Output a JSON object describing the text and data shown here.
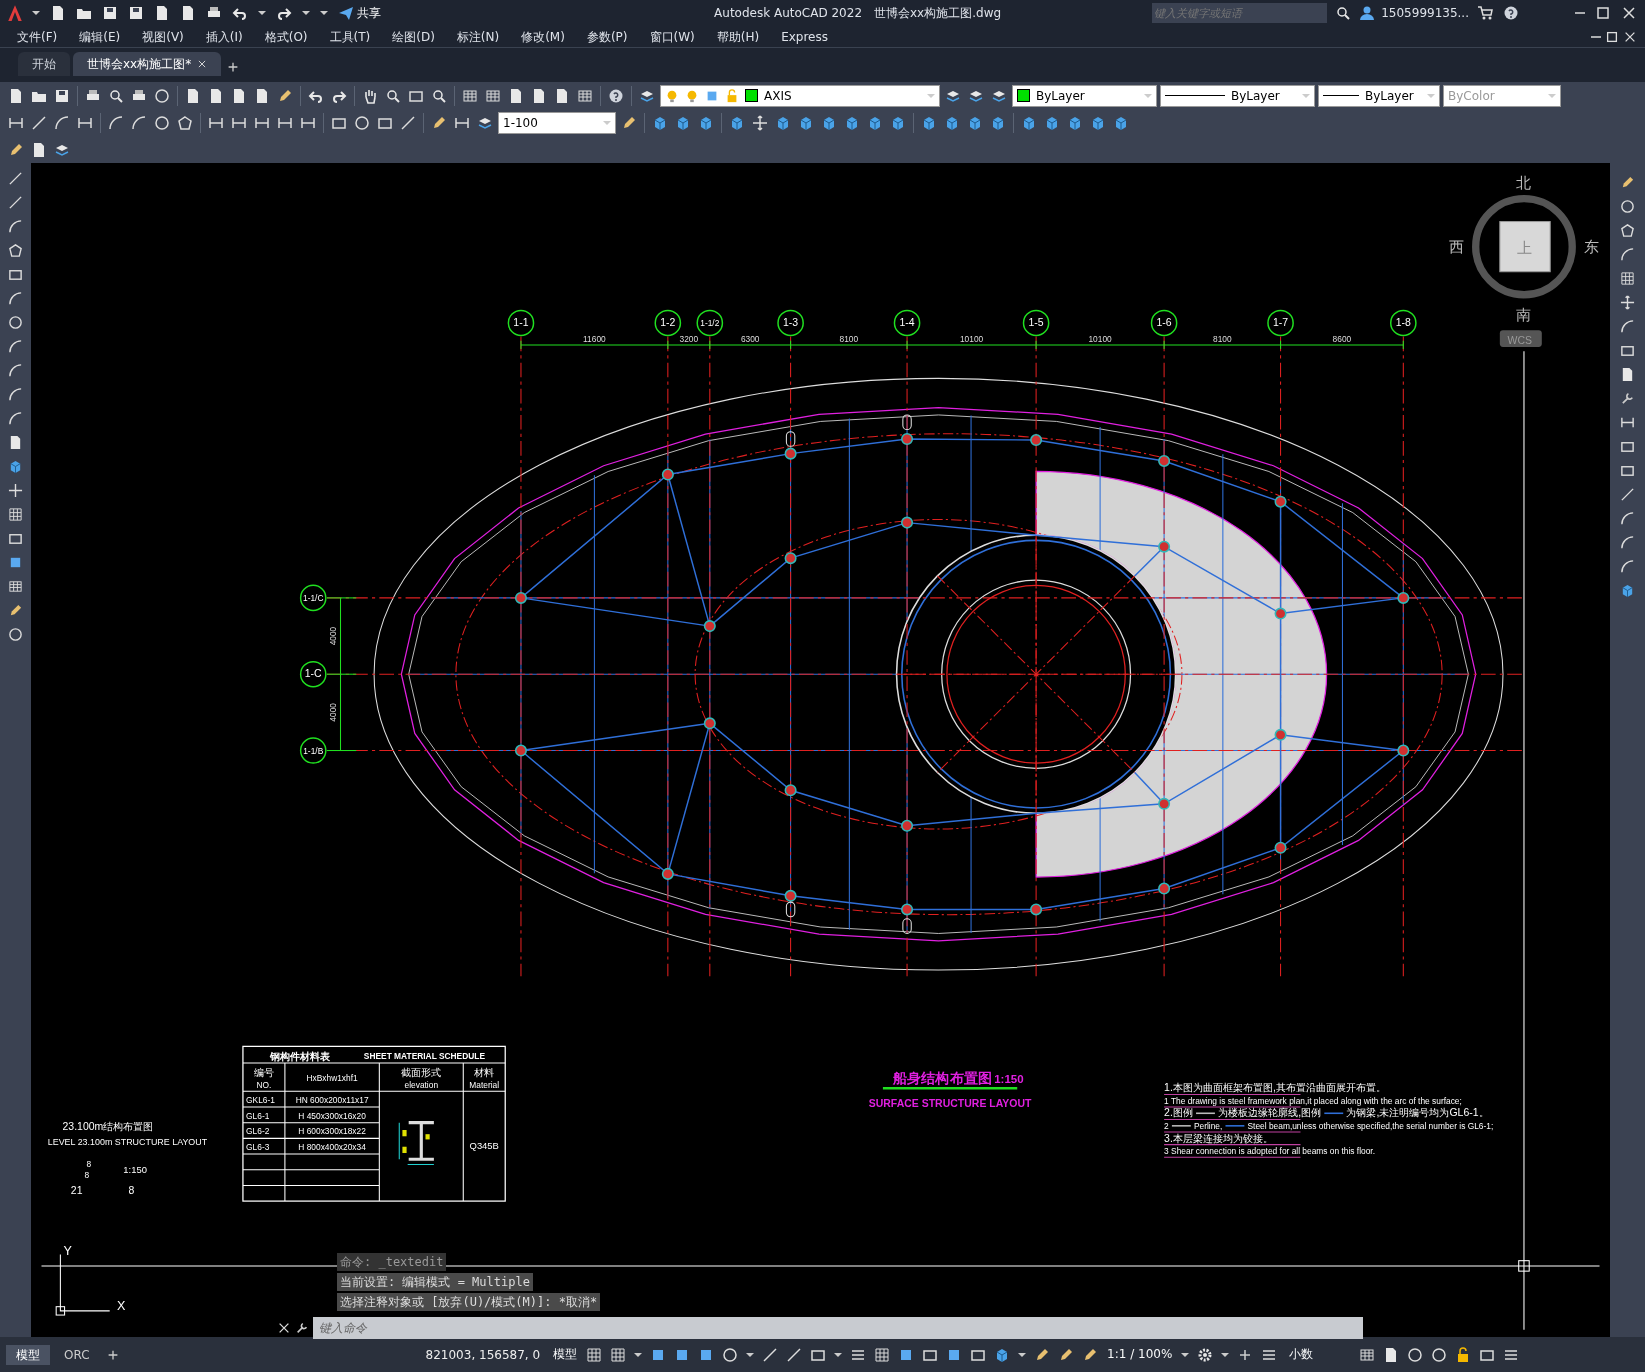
{
  "title_bar": {
    "share": "共享",
    "app_title": "Autodesk AutoCAD 2022",
    "file_name": "世博会xx构施工图.dwg",
    "search": {
      "placeholder": "键入关键字或短语"
    },
    "user": "1505999135..."
  },
  "menu": [
    "文件(F)",
    "编辑(E)",
    "视图(V)",
    "插入(I)",
    "格式(O)",
    "工具(T)",
    "绘图(D)",
    "标注(N)",
    "修改(M)",
    "参数(P)",
    "窗口(W)",
    "帮助(H)",
    "Express"
  ],
  "doc_tabs": [
    {
      "label": "开始",
      "selected": false
    },
    {
      "label": "世博会xx构施工图*",
      "selected": true
    }
  ],
  "properties": {
    "layer": "AXIS",
    "scale": "1-100",
    "swatch_text": "ByLayer",
    "linetype": "ByLayer",
    "lineweight": "ByLayer",
    "plot_style": {
      "label": "ByColor",
      "disabled": true
    }
  },
  "drawing": {
    "column_axes": [
      "1-1",
      "1-2",
      "1-1/2",
      "1-3",
      "1-4",
      "1-5",
      "1-6",
      "1-7",
      "1-8"
    ],
    "column_dims": [
      "11600",
      "3200",
      "6300",
      "8100",
      "10100",
      "10100",
      "8100",
      "8600"
    ],
    "row_axes": [
      "1-1/C",
      "1-C",
      "1-1/B"
    ],
    "row_dims": [
      "4000",
      "4000"
    ],
    "level_title": "23.100m结构布置图",
    "level_subtitle": "LEVEL 23.100m STRUCTURE LAYOUT",
    "scale_block": [
      "8",
      "8",
      "1:150",
      "21",
      "8"
    ],
    "plan_title": "船身结构布置图",
    "plan_scale": "1:150",
    "plan_subtitle": "SURFACE STRUCTURE LAYOUT",
    "material_table": {
      "title": "钢构件材料表",
      "title_en": "SHEET MATERIAL SCHEDULE",
      "headers": [
        [
          "编号",
          "NO."
        ],
        [
          "HxBxhw1xhf1"
        ],
        [
          "截面形式",
          "elevation"
        ],
        [
          "材料",
          "Material"
        ]
      ],
      "rows": [
        [
          "GKL6-1",
          "HN 600x200x11x17"
        ],
        [
          "GL6-1",
          "H 450x300x16x20"
        ],
        [
          "GL6-2",
          "H 600x300x18x22"
        ],
        [
          "GL6-3",
          "H 800x400x20x34"
        ]
      ],
      "material": "Q345B"
    },
    "notes": [
      [
        "1.本图为曲面框架布置图,其布置沿曲面展开布置。"
      ],
      [
        "1 The drawing is steel framework plan,it placed along with the arc of the surface;"
      ],
      [
        "2.图例",
        "为楼板边缘轮廓线,图例",
        "为钢梁,未注明编号均为GL6-1。"
      ],
      [
        "2",
        "Perline,",
        "Steel beam,unless otherwise specified,the serial number is GL6-1;"
      ],
      [
        "3.本层梁连接均为铰接。"
      ],
      [
        "3 Shear connection is adopted for all beams on this floor."
      ]
    ]
  },
  "viewcube": {
    "north": "北",
    "south": "南",
    "east": "东",
    "west": "西",
    "face": "上",
    "ucs": "WCS"
  },
  "ucs_icon": {
    "x": "X",
    "y": "Y"
  },
  "command_history": [
    "命令: _textedit",
    "当前设置: 编辑模式 = Multiple",
    "选择注释对象或 [放弃(U)/模式(M)]: *取消*"
  ],
  "command_line": {
    "placeholder": "键入命令"
  },
  "layout_tabs": [
    {
      "label": "模型",
      "selected": true
    },
    {
      "label": "ORC",
      "selected": false
    }
  ],
  "status_bar": {
    "coordinates": "821003, 156587, 0",
    "space": "模型",
    "scale": "1:1 / 100%",
    "units": "小数"
  }
}
